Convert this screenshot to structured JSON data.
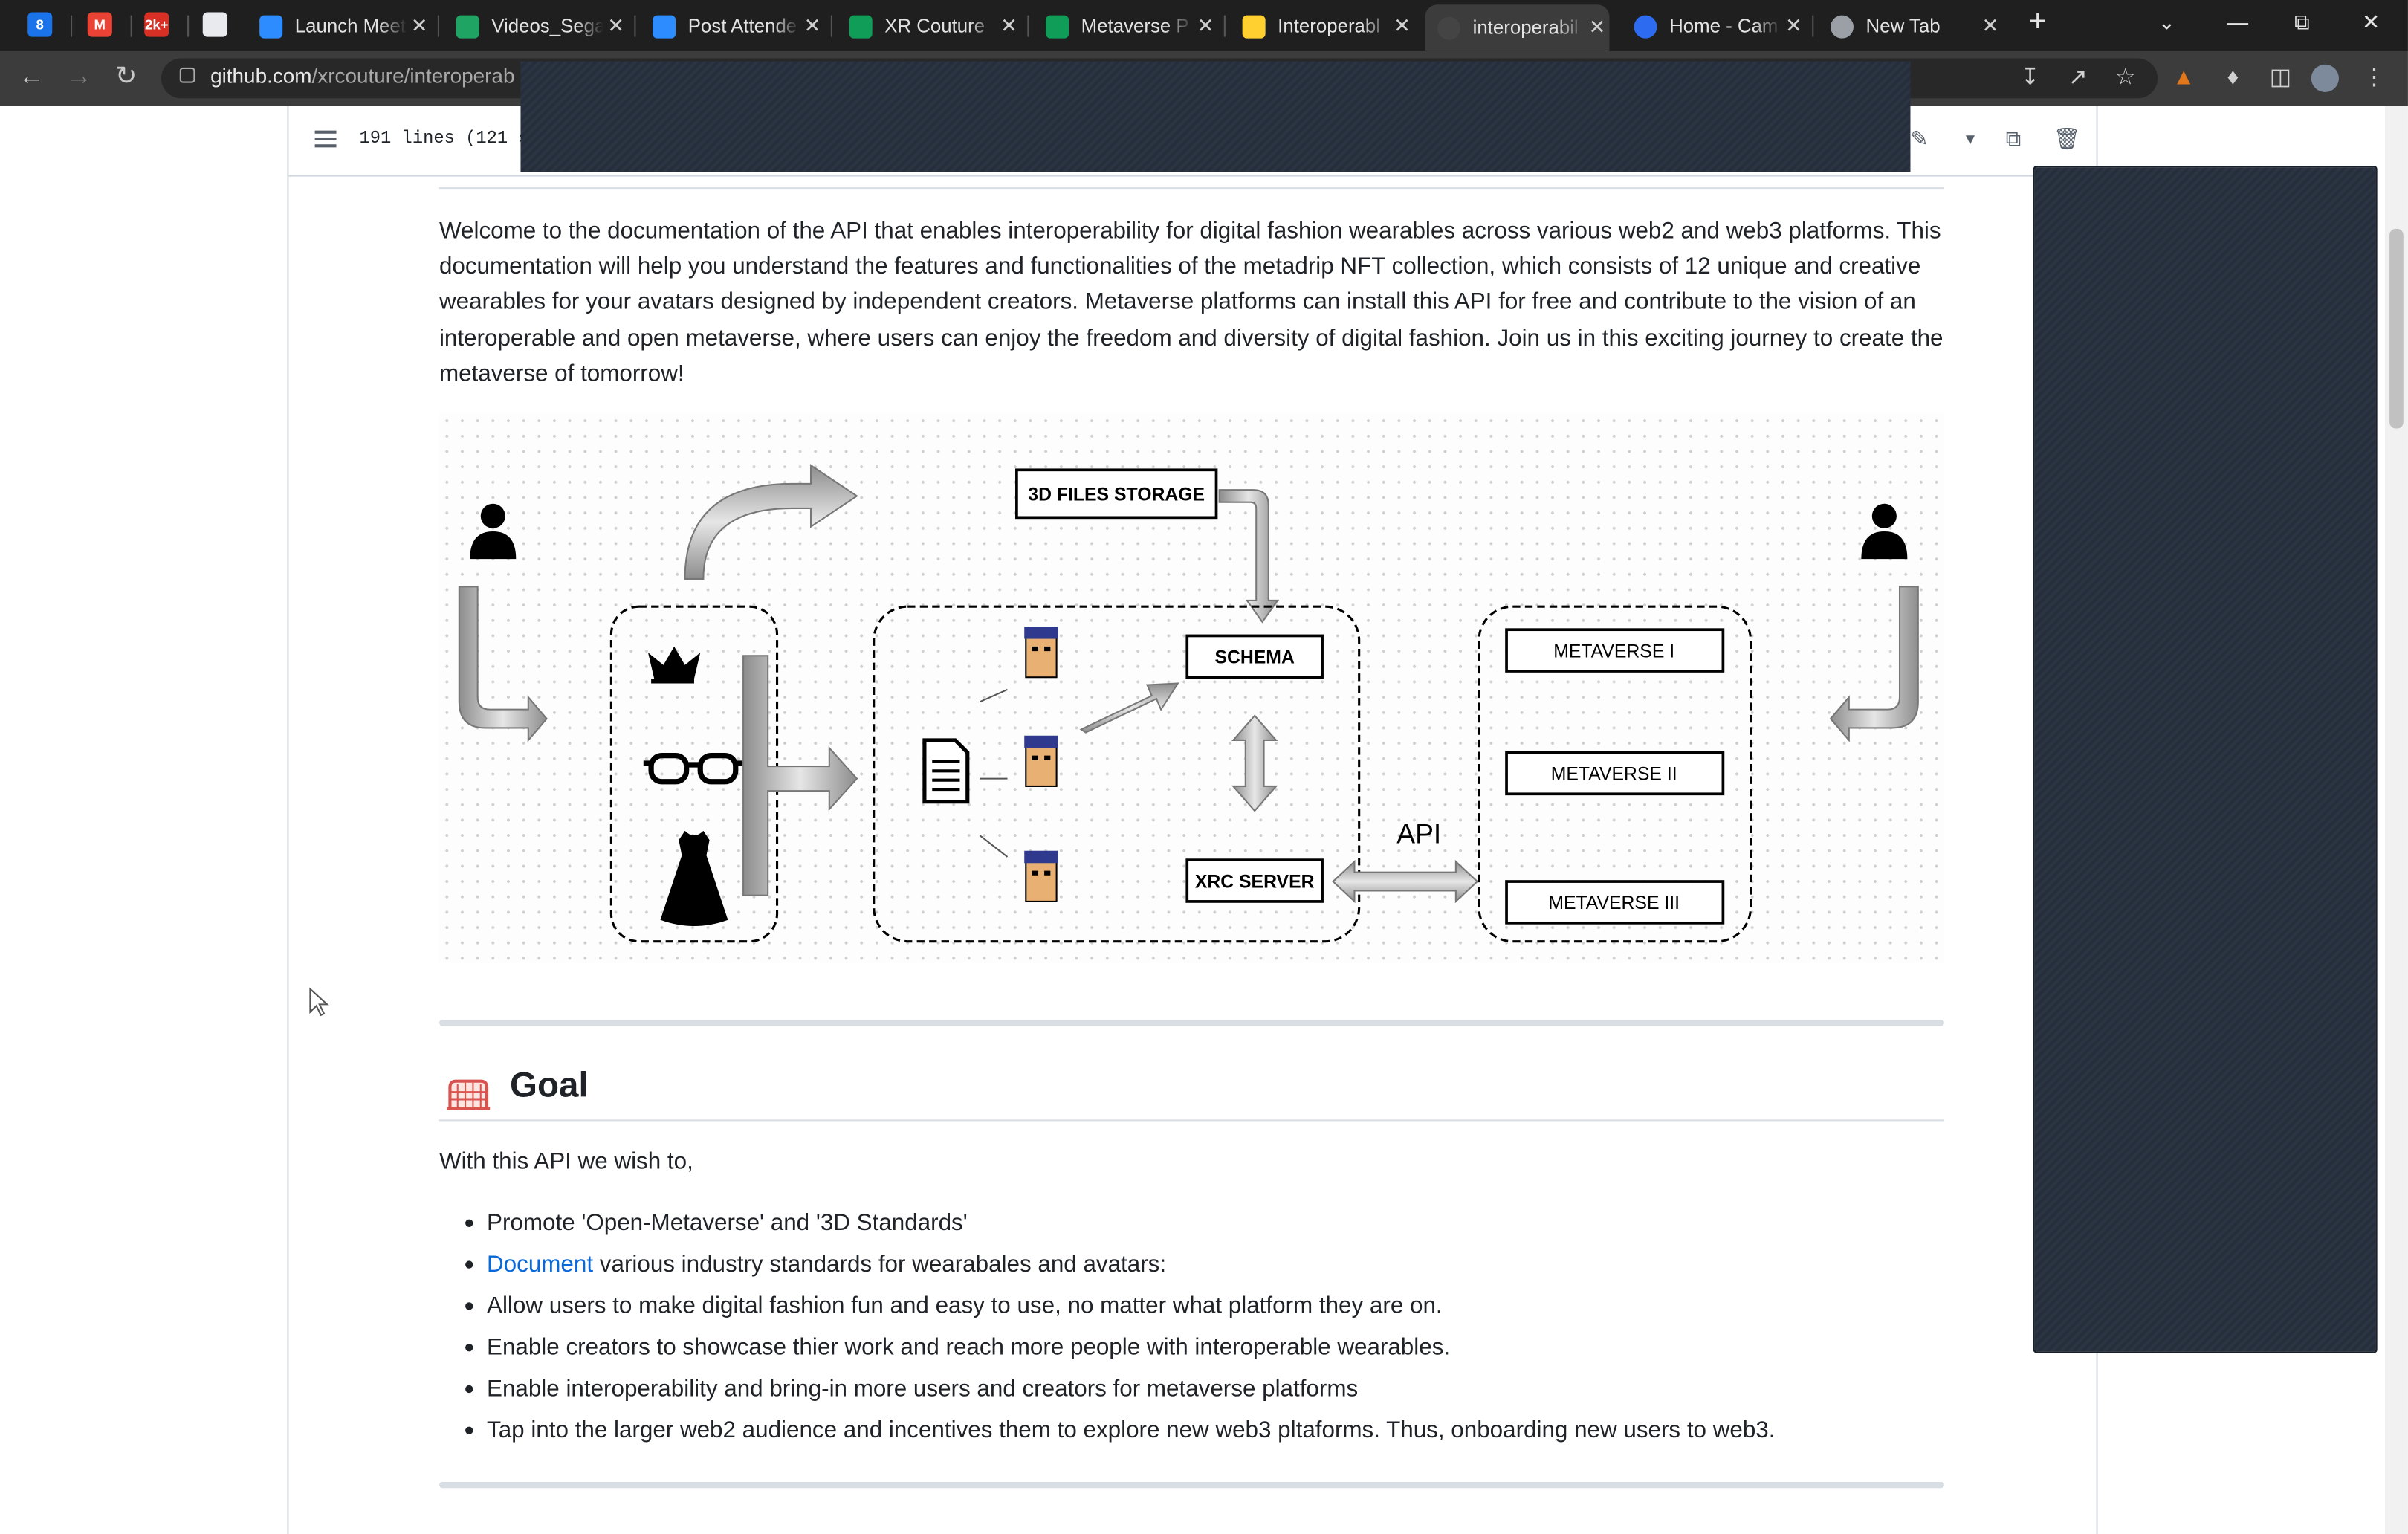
{
  "browser": {
    "tabs": [
      {
        "title": "Launch Meet",
        "icon": "zoom-icon",
        "color": "#2d8cff"
      },
      {
        "title": "Videos_Sega",
        "icon": "google-drive-icon",
        "color": "#1fa463"
      },
      {
        "title": "Post Attende",
        "icon": "zoom-icon",
        "color": "#2d8cff"
      },
      {
        "title": "XR Couture",
        "icon": "sheets-icon",
        "color": "#0f9d58"
      },
      {
        "title": "Metaverse P",
        "icon": "sheets-icon",
        "color": "#0f9d58"
      },
      {
        "title": "Interoperabl",
        "icon": "miro-icon",
        "color": "#ffd02f"
      },
      {
        "title": "interoperabil",
        "icon": "github-icon",
        "color": "#444444"
      },
      {
        "title": "Home - Cam",
        "icon": "canva-icon",
        "color": "#2d6bf0"
      },
      {
        "title": "New Tab",
        "icon": "chrome-icon",
        "color": "#9aa0a6"
      }
    ],
    "pinned_tabs": [
      {
        "label": "8",
        "icon": "calendar-icon",
        "color": "#1a73e8"
      },
      {
        "label": "M",
        "icon": "gmail-icon",
        "color": "#ea4335"
      },
      {
        "label": "2k+",
        "icon": "notifications-icon",
        "color": "#d93025"
      },
      {
        "label": "",
        "icon": "slides-icon",
        "color": "#e8eaed"
      }
    ],
    "new_tab_label": "+",
    "url_domain": "github.com",
    "url_path": "/xrcouture/interoperab"
  },
  "file": {
    "lines_info": "191 lines (121 s"
  },
  "readme": {
    "intro": "Welcome to the documentation of the API that enables interoperability for digital fashion wearables across various web2 and web3 platforms. This documentation will help you understand the features and functionalities of the metadrip NFT collection, which consists of 12 unique and creative wearables for your avatars designed by independent creators. Metaverse platforms can install this API for free and contribute to the vision of an interoperable and open metaverse, where users can enjoy the freedom and diversity of digital fashion. Join us in this exciting journey to create the metaverse of tomorrow!",
    "diagram": {
      "storage": "3D FILES STORAGE",
      "schema": "SCHEMA",
      "server": "XRC SERVER",
      "api": "API",
      "metaverses": [
        "METAVERSE I",
        "METAVERSE II",
        "METAVERSE III"
      ]
    },
    "goal_title": "Goal",
    "goal_intro": "With this API we wish to,",
    "goals": [
      {
        "text": "Promote 'Open-Metaverse' and '3D Standards'"
      },
      {
        "link": "Document",
        "text": " various industry standards for wearabales and avatars:"
      },
      {
        "text": "Allow users to make digital fashion fun and easy to use, no matter what platform they are on."
      },
      {
        "text": "Enable creators to showcase thier work and reach more people with interoperable wearables."
      },
      {
        "text": "Enable interoperability and bring-in more users and creators for metaverse platforms"
      },
      {
        "text": "Tap into the larger web2 audience and incentives them to explore new web3 pltaforms. Thus, onboarding new users to web3."
      }
    ]
  },
  "colors": {
    "link": "#0969da",
    "text": "#1f2328",
    "chrome_dark": "#1f1f1f"
  }
}
